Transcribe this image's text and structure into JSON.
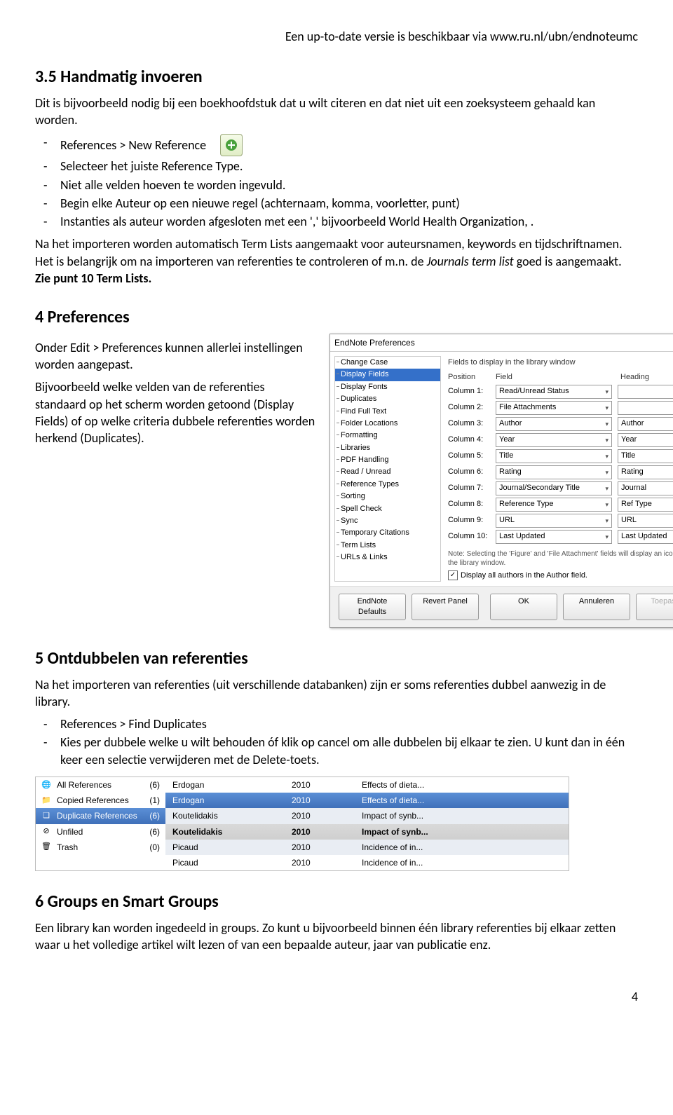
{
  "header_note": "Een up-to-date versie is beschikbaar via www.ru.nl/ubn/endnoteumc",
  "s35": {
    "title": "3.5    Handmatig invoeren",
    "intro": "Dit is bijvoorbeeld nodig bij een boekhoofdstuk dat u wilt citeren en dat niet uit een zoeksysteem gehaald kan worden.",
    "items": [
      "References > New Reference",
      "Selecteer het juiste Reference Type.",
      "Niet alle velden hoeven te worden ingevuld.",
      "Begin elke Auteur op een nieuwe regel (achternaam, komma, voorletter, punt)",
      "Instanties als auteur worden afgesloten met een ',' bijvoorbeeld World Health Organization, ."
    ],
    "followup_1": "Na het importeren worden automatisch Term Lists aangemaakt voor auteursnamen, keywords en tijdschriftnamen. Het is belangrijk om na importeren van referenties te controleren of m.n. de ",
    "followup_italic": "Journals term list",
    "followup_2": " goed is aangemaakt. ",
    "followup_bold": "Zie punt 10 Term Lists."
  },
  "s4": {
    "title": "4     Preferences",
    "p1": "Onder Edit > Preferences kunnen allerlei instellingen worden aangepast.",
    "p2": "Bijvoorbeeld welke velden van de referenties standaard op het scherm worden getoond (Display Fields) of op welke criteria dubbele referenties worden herkend  (Duplicates)."
  },
  "prefs": {
    "title": "EndNote Preferences",
    "tree": [
      "Change Case",
      "Display Fields",
      "Display Fonts",
      "Duplicates",
      "Find Full Text",
      "Folder Locations",
      "Formatting",
      "Libraries",
      "PDF Handling",
      "Read / Unread",
      "Reference Types",
      "Sorting",
      "Spell Check",
      "Sync",
      "Temporary Citations",
      "Term Lists",
      "URLs & Links"
    ],
    "caption": "Fields to display in the library window",
    "hdr_pos": "Position",
    "hdr_field": "Field",
    "hdr_head": "Heading",
    "rows": [
      {
        "pos": "Column 1:",
        "field": "Read/Unread Status",
        "heading": ""
      },
      {
        "pos": "Column 2:",
        "field": "File Attachments",
        "heading": ""
      },
      {
        "pos": "Column 3:",
        "field": "Author",
        "heading": "Author"
      },
      {
        "pos": "Column 4:",
        "field": "Year",
        "heading": "Year"
      },
      {
        "pos": "Column 5:",
        "field": "Title",
        "heading": "Title"
      },
      {
        "pos": "Column 6:",
        "field": "Rating",
        "heading": "Rating"
      },
      {
        "pos": "Column 7:",
        "field": "Journal/Secondary Title",
        "heading": "Journal"
      },
      {
        "pos": "Column 8:",
        "field": "Reference Type",
        "heading": "Ref Type"
      },
      {
        "pos": "Column 9:",
        "field": "URL",
        "heading": "URL"
      },
      {
        "pos": "Column 10:",
        "field": "Last Updated",
        "heading": "Last Updated"
      }
    ],
    "note": "Note: Selecting the 'Figure' and 'File Attachment' fields will display an icon in the library window.",
    "checkbox": "Display all authors in the Author field.",
    "buttons": {
      "defaults": "EndNote Defaults",
      "revert": "Revert Panel",
      "ok": "OK",
      "cancel": "Annuleren",
      "apply": "Toepassen"
    }
  },
  "s5": {
    "title": "5     Ontdubbelen van referenties",
    "p1": "Na het  importeren van referenties (uit verschillende databanken) zijn er soms referenties dubbel aanwezig in de library.",
    "items": [
      "References > Find Duplicates",
      "Kies per dubbele welke u wilt behouden óf klik op cancel om alle dubbelen bij elkaar te zien. U kunt dan in één keer een selectie verwijderen met de Delete-toets."
    ]
  },
  "dup_nav": [
    {
      "icon": "globe-icon",
      "label": "All References",
      "count": "(6)"
    },
    {
      "icon": "folder-icon",
      "label": "Copied References",
      "count": "(1)"
    },
    {
      "icon": "dup-icon",
      "label": "Duplicate References",
      "count": "(6)",
      "selected": true
    },
    {
      "icon": "unfiled-icon",
      "label": "Unfiled",
      "count": "(6)"
    },
    {
      "icon": "trash-icon",
      "label": "Trash",
      "count": "(0)"
    }
  ],
  "dup_rows": [
    {
      "auth": "Erdogan",
      "year": "2010",
      "title": "Effects of dieta...",
      "cls": ""
    },
    {
      "auth": "Erdogan",
      "year": "2010",
      "title": "Effects of dieta...",
      "cls": "sel"
    },
    {
      "auth": "Koutelidakis",
      "year": "2010",
      "title": "Impact of synb...",
      "cls": "even"
    },
    {
      "auth": "Koutelidakis",
      "year": "2010",
      "title": "Impact of synb...",
      "cls": "selgray"
    },
    {
      "auth": "Picaud",
      "year": "2010",
      "title": "Incidence of in...",
      "cls": "even"
    },
    {
      "auth": "Picaud",
      "year": "2010",
      "title": "Incidence of in...",
      "cls": ""
    }
  ],
  "s6": {
    "title": "6     Groups en Smart Groups",
    "p1": "Een library kan worden ingedeeld in groups. Zo kunt u bijvoorbeeld binnen één library referenties bij elkaar zetten waar u het volledige artikel wilt lezen of van een bepaalde auteur, jaar van publicatie enz."
  },
  "page_number": "4"
}
